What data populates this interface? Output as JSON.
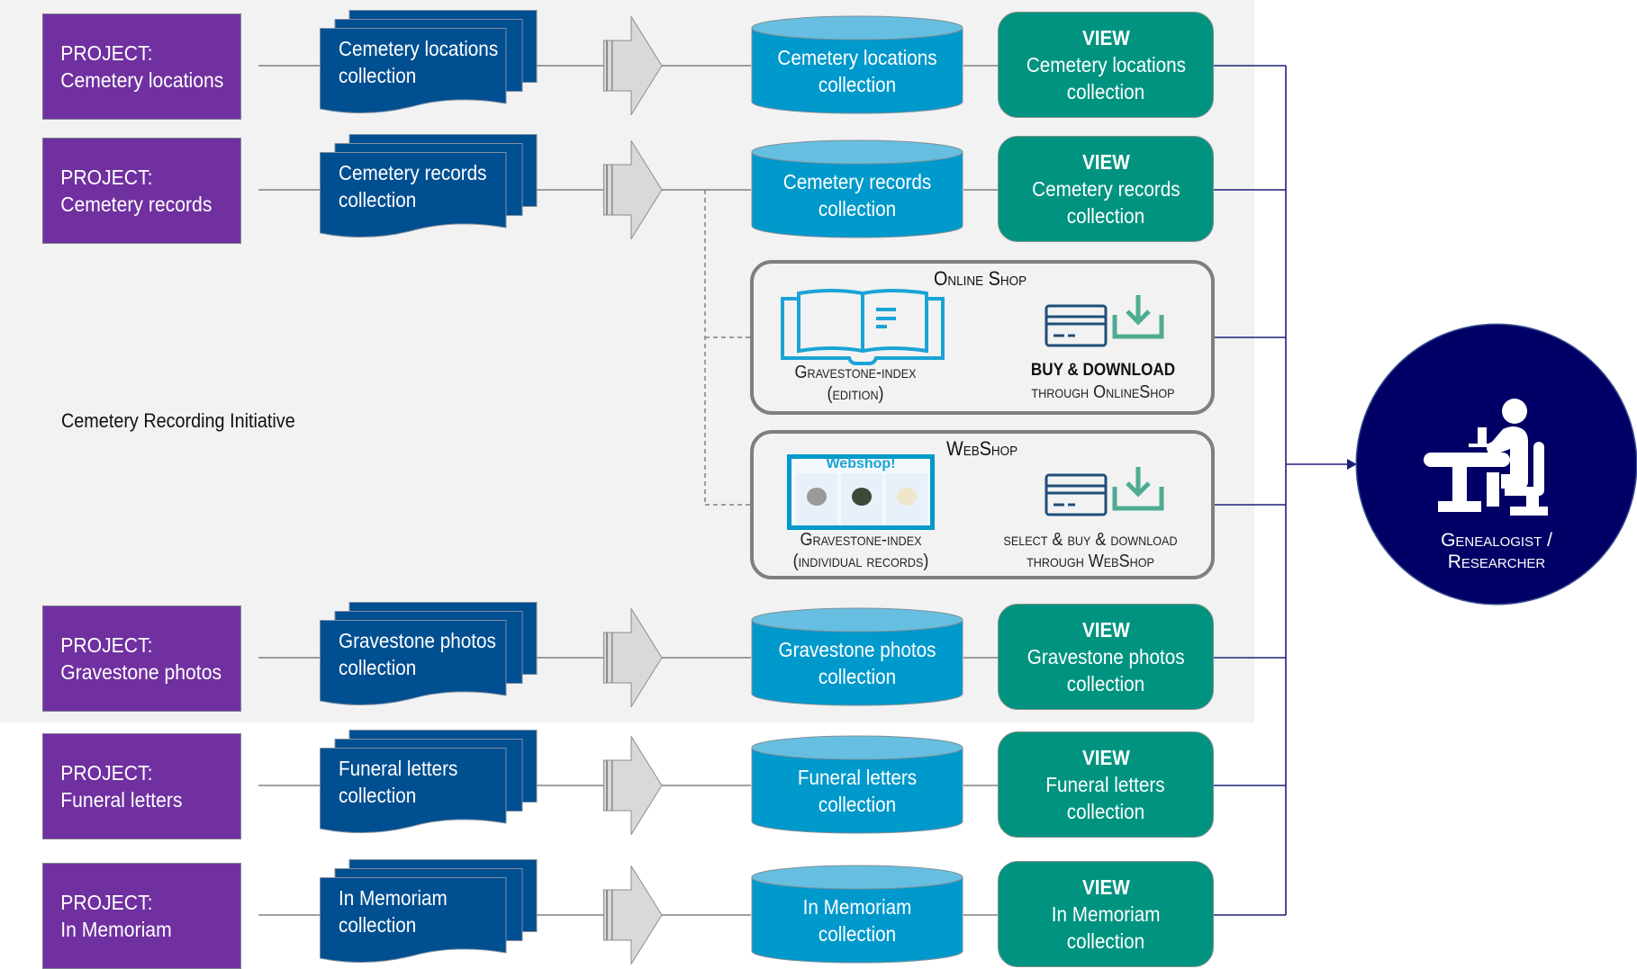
{
  "colors": {
    "background_panel": "#f2f2f2",
    "project": "#7030a0",
    "collection_doc": "#004f91",
    "database": "#0099cc",
    "database_top": "#66bfe0",
    "view": "#009480",
    "persona": "#000066",
    "connector": "#1f1f7a",
    "shop_border": "#7f7f7f",
    "book_icon": "#1aa3d6",
    "card_icon": "#1f4e79",
    "download_icon": "#4fac93"
  },
  "group_label": "Cemetery Recording Initiative",
  "rows": [
    {
      "project": {
        "prefix": "PROJECT:",
        "name": "Cemetery locations"
      },
      "collection": {
        "line1": "Cemetery locations",
        "line2": "collection"
      },
      "database": {
        "line1": "Cemetery locations",
        "line2": "collection"
      },
      "view": {
        "title": "VIEW",
        "line1": "Cemetery locations",
        "line2": "collection"
      }
    },
    {
      "project": {
        "prefix": "PROJECT:",
        "name": "Cemetery records"
      },
      "collection": {
        "line1": "Cemetery records",
        "line2": "collection"
      },
      "database": {
        "line1": "Cemetery records",
        "line2": "collection"
      },
      "view": {
        "title": "VIEW",
        "line1": "Cemetery records",
        "line2": "collection"
      }
    },
    {
      "project": {
        "prefix": "PROJECT:",
        "name": "Gravestone photos"
      },
      "collection": {
        "line1": "Gravestone photos",
        "line2": "collection"
      },
      "database": {
        "line1": "Gravestone photos",
        "line2": "collection"
      },
      "view": {
        "title": "VIEW",
        "line1": "Gravestone photos",
        "line2": "collection"
      }
    },
    {
      "project": {
        "prefix": "PROJECT:",
        "name": "Funeral letters"
      },
      "collection": {
        "line1": "Funeral letters",
        "line2": "collection"
      },
      "database": {
        "line1": "Funeral letters",
        "line2": "collection"
      },
      "view": {
        "title": "VIEW",
        "line1": "Funeral letters",
        "line2": "collection"
      }
    },
    {
      "project": {
        "prefix": "PROJECT:",
        "name": "In Memoriam"
      },
      "collection": {
        "line1": "In Memoriam",
        "line2": "collection"
      },
      "database": {
        "line1": "In Memoriam",
        "line2": "collection"
      },
      "view": {
        "title": "VIEW",
        "line1": "In Memoriam",
        "line2": "collection"
      }
    }
  ],
  "online_shop": {
    "title": "Online Shop",
    "product_line1": "Gravestone-index",
    "product_line2": "(edition)",
    "action_line1": "BUY & DOWNLOAD",
    "action_line2": "through OnlineShop",
    "product_icon": "open-book-icon",
    "action_icons": [
      "credit-card-icon",
      "download-icon"
    ]
  },
  "web_shop": {
    "title": "WebShop",
    "thumbnail_title": "Webshop!",
    "product_line1": "Gravestone-index",
    "product_line2": "(individual records)",
    "action_line1": "select & buy & download",
    "action_line2": "through WebShop",
    "product_icon": "webshop-screenshot-thumbnail",
    "action_icons": [
      "credit-card-icon",
      "download-icon"
    ]
  },
  "persona": {
    "line1": "Genealogist /",
    "line2": "Researcher",
    "icon": "person-at-desk-icon"
  }
}
